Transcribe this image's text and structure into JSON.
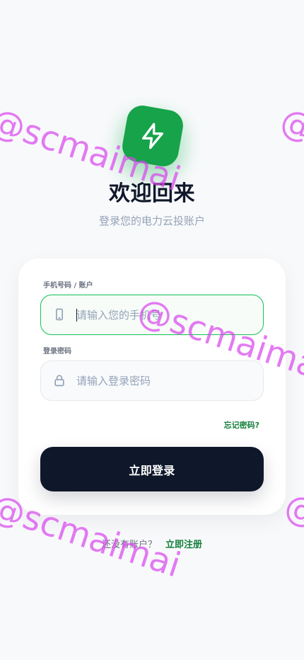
{
  "header": {
    "title": "欢迎回来",
    "subtitle": "登录您的电力云投账户"
  },
  "form": {
    "phone_label": "手机号码 / 账户",
    "phone_placeholder": "请输入您的手机号",
    "password_label": "登录密码",
    "password_placeholder": "请输入登录密码",
    "forgot_label": "忘记密码?",
    "submit_label": "立即登录"
  },
  "footer": {
    "prompt": "还没有账户？",
    "signup_label": "立即注册"
  },
  "watermark": {
    "text": "@scmaimai"
  },
  "icons": {
    "logo": "lightning-bolt-icon",
    "phone": "phone-icon",
    "password": "lock-icon"
  },
  "colors": {
    "accent": "#16a34a",
    "button": "#0f172a",
    "watermark": "#d946ef"
  }
}
